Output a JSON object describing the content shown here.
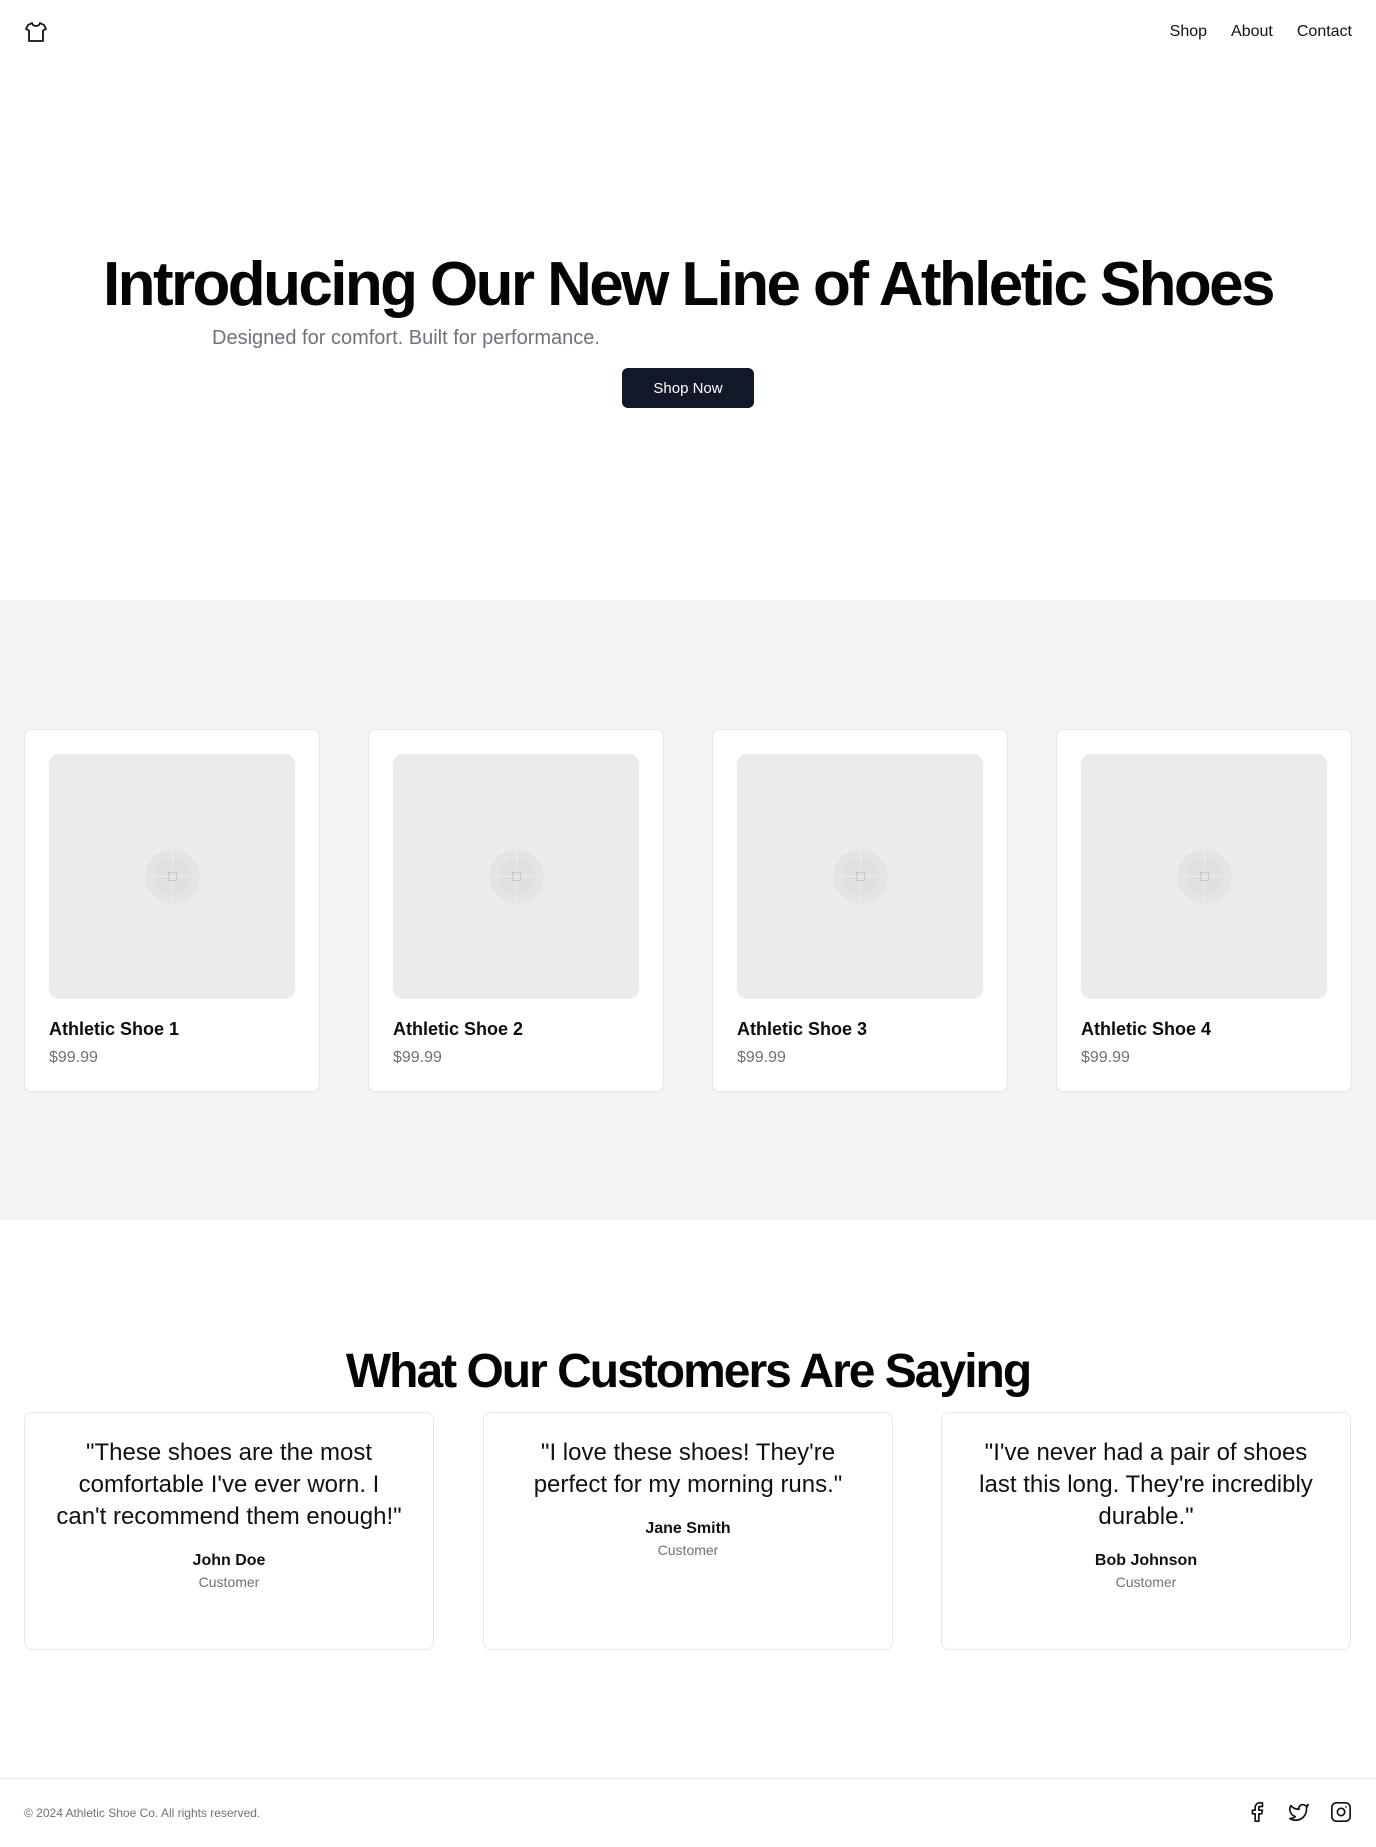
{
  "nav": {
    "logo_icon": "shirt-icon",
    "items": [
      "Shop",
      "About",
      "Contact"
    ]
  },
  "hero": {
    "title": "Introducing Our New Line of Athletic Shoes",
    "subtitle": "Designed for comfort. Built for performance.",
    "cta_label": "Shop Now"
  },
  "products": [
    {
      "name": "Athletic Shoe 1",
      "price": "$99.99"
    },
    {
      "name": "Athletic Shoe 2",
      "price": "$99.99"
    },
    {
      "name": "Athletic Shoe 3",
      "price": "$99.99"
    },
    {
      "name": "Athletic Shoe 4",
      "price": "$99.99"
    }
  ],
  "testimonials": {
    "title": "What Our Customers Are Saying",
    "items": [
      {
        "quote": "\"These shoes are the most comfortable I've ever worn. I can't recommend them enough!\"",
        "author": "John Doe",
        "role": "Customer"
      },
      {
        "quote": "\"I love these shoes! They're perfect for my morning runs.\"",
        "author": "Jane Smith",
        "role": "Customer"
      },
      {
        "quote": "\"I've never had a pair of shoes last this long. They're incredibly durable.\"",
        "author": "Bob Johnson",
        "role": "Customer"
      }
    ]
  },
  "footer": {
    "copyright": "© 2024 Athletic Shoe Co. All rights reserved.",
    "social_icons": [
      "facebook-icon",
      "twitter-icon",
      "instagram-icon"
    ]
  },
  "colors": {
    "primary_button": "#111827",
    "products_bg": "#f3f4f6",
    "muted_text": "#6b7280"
  }
}
